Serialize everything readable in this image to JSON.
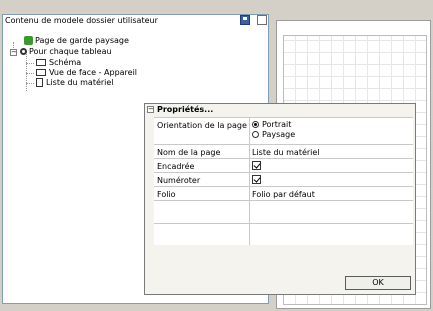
{
  "panel": {
    "title": "Contenu de modele dossier utilisateur"
  },
  "tree": {
    "items": [
      {
        "label": "Page de garde paysage",
        "icon": "page-green-icon"
      },
      {
        "label": "Pour chaque tableau",
        "icon": "loop-icon"
      },
      {
        "label": "Schéma",
        "icon": "sheet-icon"
      },
      {
        "label": "Vue de face - Appareil",
        "icon": "sheet-icon"
      },
      {
        "label": "Liste du matériel",
        "icon": "list-icon"
      }
    ]
  },
  "props": {
    "title": "Propriétés...",
    "rows": [
      {
        "label": "Orientation de la page",
        "options": [
          "Portrait",
          "Paysage"
        ],
        "selected": "Portrait"
      },
      {
        "label": "Nom de la page",
        "value": "Liste du matériel"
      },
      {
        "label": "Encadrée",
        "checked": true
      },
      {
        "label": "Numéroter",
        "checked": true
      },
      {
        "label": "Folio",
        "value": "Folio par défaut"
      }
    ],
    "ok_label": "OK"
  }
}
